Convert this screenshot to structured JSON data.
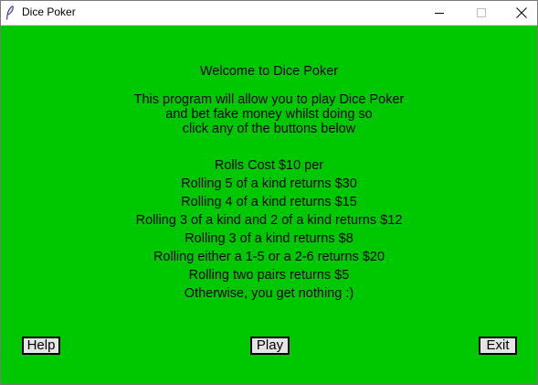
{
  "window": {
    "title": "Dice Poker",
    "icon": "feather-icon",
    "controls": [
      "minimize-icon",
      "maximize-icon",
      "close-icon"
    ]
  },
  "colors": {
    "background": "#00c800",
    "button_face": "#e5e5e5"
  },
  "content": {
    "welcome": "Welcome to Dice Poker",
    "intro": [
      "This program will allow you to play Dice Poker",
      "and bet fake money whilst doing so",
      "click any of the buttons below"
    ],
    "rules": [
      "Rolls Cost $10 per",
      "Rolling 5 of a kind returns $30",
      "Rolling 4 of a kind returns $15",
      "Rolling 3 of a kind and 2 of a kind returns $12",
      "Rolling 3 of a kind returns $8",
      "Rolling either a 1-5 or a 2-6 returns $20",
      "Rolling two pairs returns $5",
      "Otherwise, you get nothing :)"
    ]
  },
  "buttons": {
    "help": "Help",
    "play": "Play",
    "exit": "Exit"
  }
}
